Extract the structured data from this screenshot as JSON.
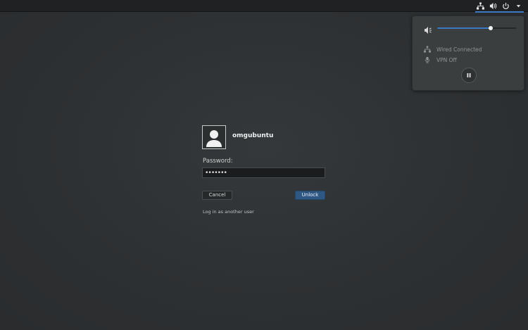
{
  "topbar": {
    "icons": [
      "network-icon",
      "volume-icon",
      "power-icon",
      "caret-down-icon"
    ]
  },
  "menu": {
    "volume": {
      "level": 0.68,
      "icon": "volume-muted-icon"
    },
    "wired": {
      "label": "Wired Connected",
      "icon": "network-icon"
    },
    "vpn": {
      "label": "VPN Off",
      "icon": "microphone-icon"
    },
    "pause_icon": "pause-icon"
  },
  "login": {
    "username": "omgubuntu",
    "password_label": "Password:",
    "password_value": "•••••••",
    "cancel_label": "Cancel",
    "unlock_label": "Unlock",
    "other_user_link": "Log in as another user"
  },
  "colors": {
    "accent": "#3b79c4",
    "unlock_button": "#2f5784",
    "background": "#2e3133"
  }
}
